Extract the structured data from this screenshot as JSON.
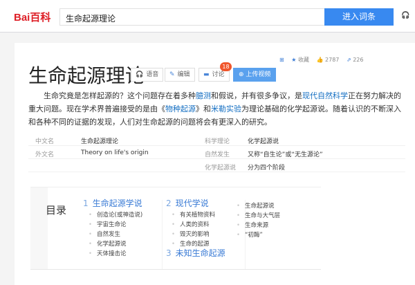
{
  "header": {
    "logo": "Bai百科",
    "search_value": "生命起源理论",
    "go_button": "进入词条"
  },
  "title": "生命起源理论",
  "buttons": {
    "voice": "语音",
    "edit": "编辑",
    "discuss": "讨论",
    "discuss_count": "18",
    "upload": "上传视频"
  },
  "actions": {
    "collect": "收藏",
    "likes": "2787",
    "shares": "226"
  },
  "paragraph": [
    {
      "t": "生命究竟是怎样起源的？这个问题存在着多种"
    },
    {
      "t": "臆测",
      "link": true
    },
    {
      "t": "和假说，并有很多争议，是"
    },
    {
      "t": "现代自然科学",
      "link": true
    },
    {
      "t": "正在努力解决的重大问题。现在学术界普遍接受的是由《"
    },
    {
      "t": "物种起源",
      "link": true
    },
    {
      "t": "》和"
    },
    {
      "t": "米勒实验",
      "link": true
    },
    {
      "t": "为理论基础的化学起源说。随着认识的不断深入和各种不同的证据的发现，人们对生命起源的问题将会有更深入的研究。"
    }
  ],
  "info": [
    {
      "l1": "中文名",
      "v1": "生命起源理论",
      "l2": "科学理论",
      "v2": "化学起源说"
    },
    {
      "l1": "外文名",
      "v1": "Theory on life's origin",
      "l2": "自然发生",
      "v2": "又称“自生论”或“无生源论”"
    },
    {
      "l1": "",
      "v1": "",
      "l2": "化学起源说",
      "v2": "分为四个阶段"
    }
  ],
  "toc": {
    "label": "目录",
    "sections": [
      {
        "num": "1",
        "title": "生命起源学说",
        "items": [
          "创造论(或神造说)",
          "宇宙生命论",
          "自然发生",
          "化学起源说",
          "天体撞击论"
        ]
      },
      {
        "num": "2",
        "title": "现代学说",
        "items": [
          "有关植物资料",
          "人类的资料",
          "毁灭的影响",
          "生命的起源",
          "生命起源说",
          "生命与大气层",
          "生命来源",
          "“初酶”"
        ]
      },
      {
        "num": "3",
        "title": "未知生命起源",
        "items": []
      }
    ]
  },
  "colors": {
    "brand_red": "#de1e26",
    "accent_blue": "#3889f0",
    "link": "#136ec2",
    "badge": "#f0562b"
  }
}
